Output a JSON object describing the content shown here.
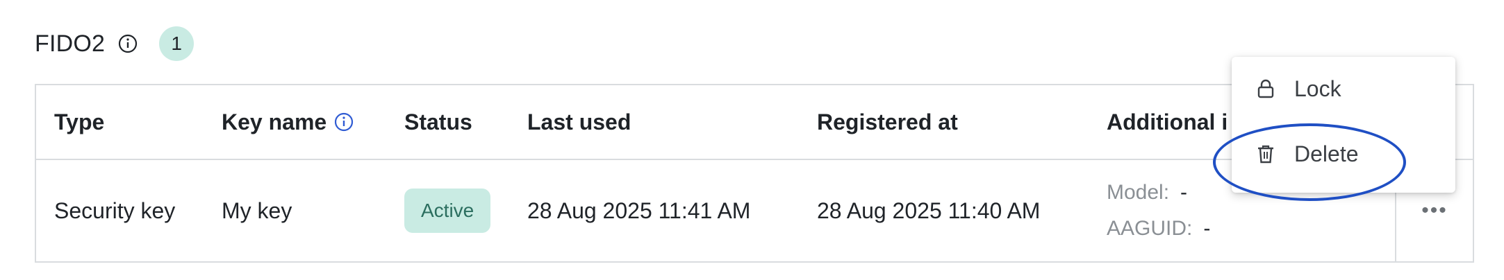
{
  "section": {
    "title": "FIDO2",
    "count": "1"
  },
  "table": {
    "headers": {
      "type": "Type",
      "key_name": "Key name",
      "status": "Status",
      "last_used": "Last used",
      "registered_at": "Registered at",
      "additional_info": "Additional i"
    },
    "rows": [
      {
        "type": "Security key",
        "key_name": "My key",
        "status": "Active",
        "last_used": "28 Aug 2025 11:41 AM",
        "registered_at": "28 Aug 2025 11:40 AM",
        "model_label": "Model:",
        "model_value": "-",
        "aaguid_label": "AAGUID:",
        "aaguid_value": "-",
        "actions": "•••"
      }
    ]
  },
  "menu": {
    "items": [
      {
        "label": "Lock"
      },
      {
        "label": "Delete"
      }
    ]
  },
  "colors": {
    "badge_bg": "#c9ebe3",
    "status_text": "#2b6e5f",
    "info_icon": "#2f5bd3",
    "highlight": "#1f4fc4"
  },
  "icons": {
    "header_info": "info-icon",
    "keyname_info": "info-icon",
    "lock": "lock-icon",
    "delete": "trash-icon",
    "actions": "more-horizontal-icon"
  }
}
